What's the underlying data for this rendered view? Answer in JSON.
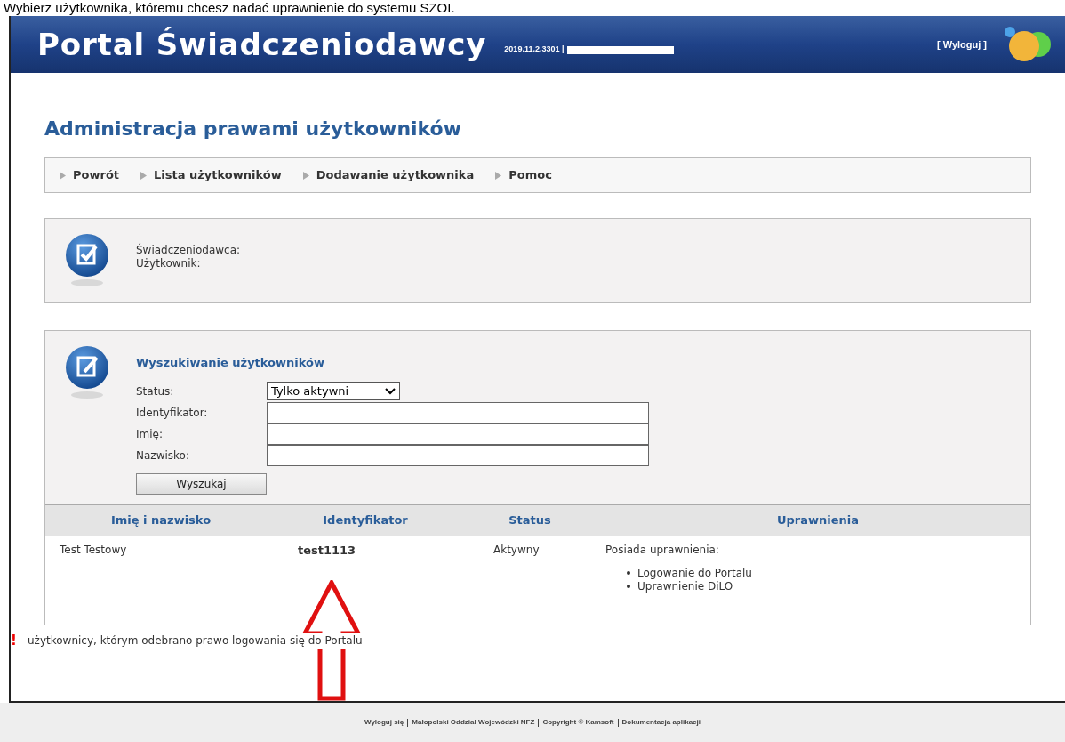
{
  "instruction": "Wybierz użytkownika, któremu chcesz nadać uprawnienie do systemu SZOI.",
  "header": {
    "title": "Portal Świadczeniodawcy",
    "version": "2019.11.2.3301 |",
    "logout": "[ Wyloguj ]"
  },
  "page_title": "Administracja prawami użytkowników",
  "nav": [
    "Powrót",
    "Lista użytkowników",
    "Dodawanie użytkownika",
    "Pomoc"
  ],
  "info": {
    "labels": [
      "Świadczeniodawca:",
      "Użytkownik:"
    ]
  },
  "search": {
    "title": "Wyszukiwanie użytkowników",
    "fields": [
      {
        "kind": "select",
        "label": "Status:",
        "value": "Tylko aktywni"
      },
      {
        "kind": "text",
        "label": "Identyfikator:"
      },
      {
        "kind": "text",
        "label": "Imię:"
      },
      {
        "kind": "text",
        "label": "Nazwisko:"
      }
    ],
    "button": "Wyszukaj"
  },
  "table": {
    "columns": [
      "Imię i nazwisko",
      "Identyfikator",
      "Status",
      "Uprawnienia"
    ],
    "rows": [
      {
        "name": "Test Testowy",
        "id": "test1113",
        "status": "Aktywny",
        "rights_title": "Posiada uprawnienia:",
        "rights": [
          "Logowanie do Portalu",
          "Uprawnienie DiLO"
        ]
      }
    ]
  },
  "legend": {
    "mark": "!",
    "text": "- użytkownicy, którym odebrano prawo logowania się do Portalu"
  },
  "footer": [
    "Wyloguj się",
    "Małopolski Oddział Wojewódzki NFZ",
    "Copyright © Kamsoft",
    "Dokumentacja aplikacji"
  ]
}
